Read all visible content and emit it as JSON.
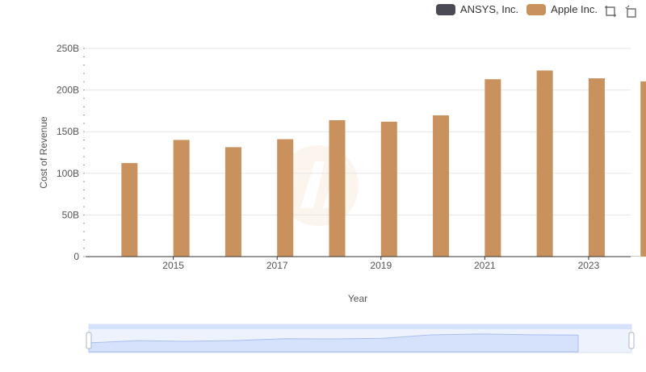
{
  "chart_data": {
    "type": "bar",
    "ylabel": "Cost of Revenue",
    "xlabel": "Year",
    "ylim": [
      0,
      250
    ],
    "y_unit": "B",
    "y_ticks": [
      "0",
      "50B",
      "100B",
      "150B",
      "200B",
      "250B"
    ],
    "x_ticks": [
      "2015",
      "2017",
      "2019",
      "2021",
      "2023"
    ],
    "categories": [
      "2014",
      "2015",
      "2016",
      "2017",
      "2018",
      "2019",
      "2020",
      "2021",
      "2022",
      "2023",
      "2024"
    ],
    "series": [
      {
        "name": "ANSYS, Inc.",
        "color": "#4a4a55",
        "values": [
          0.2,
          0.2,
          0.2,
          0.2,
          0.2,
          0.3,
          0.3,
          0.3,
          0.3,
          0.3,
          0.3
        ]
      },
      {
        "name": "Apple Inc.",
        "color": "#c9915e",
        "values": [
          112.3,
          140.1,
          131.4,
          141.0,
          163.8,
          162.0,
          169.6,
          213.0,
          223.5,
          214.1,
          210.4
        ]
      }
    ],
    "grid": true,
    "legend_position": "top-right"
  },
  "colors": {
    "accent": "#c9915e",
    "dark_series": "#4a4a55",
    "zoom_fill": "#d6e2fb"
  },
  "toolbox": {
    "zoom_icon": "zoom-icon",
    "restore_icon": "restore-icon"
  }
}
